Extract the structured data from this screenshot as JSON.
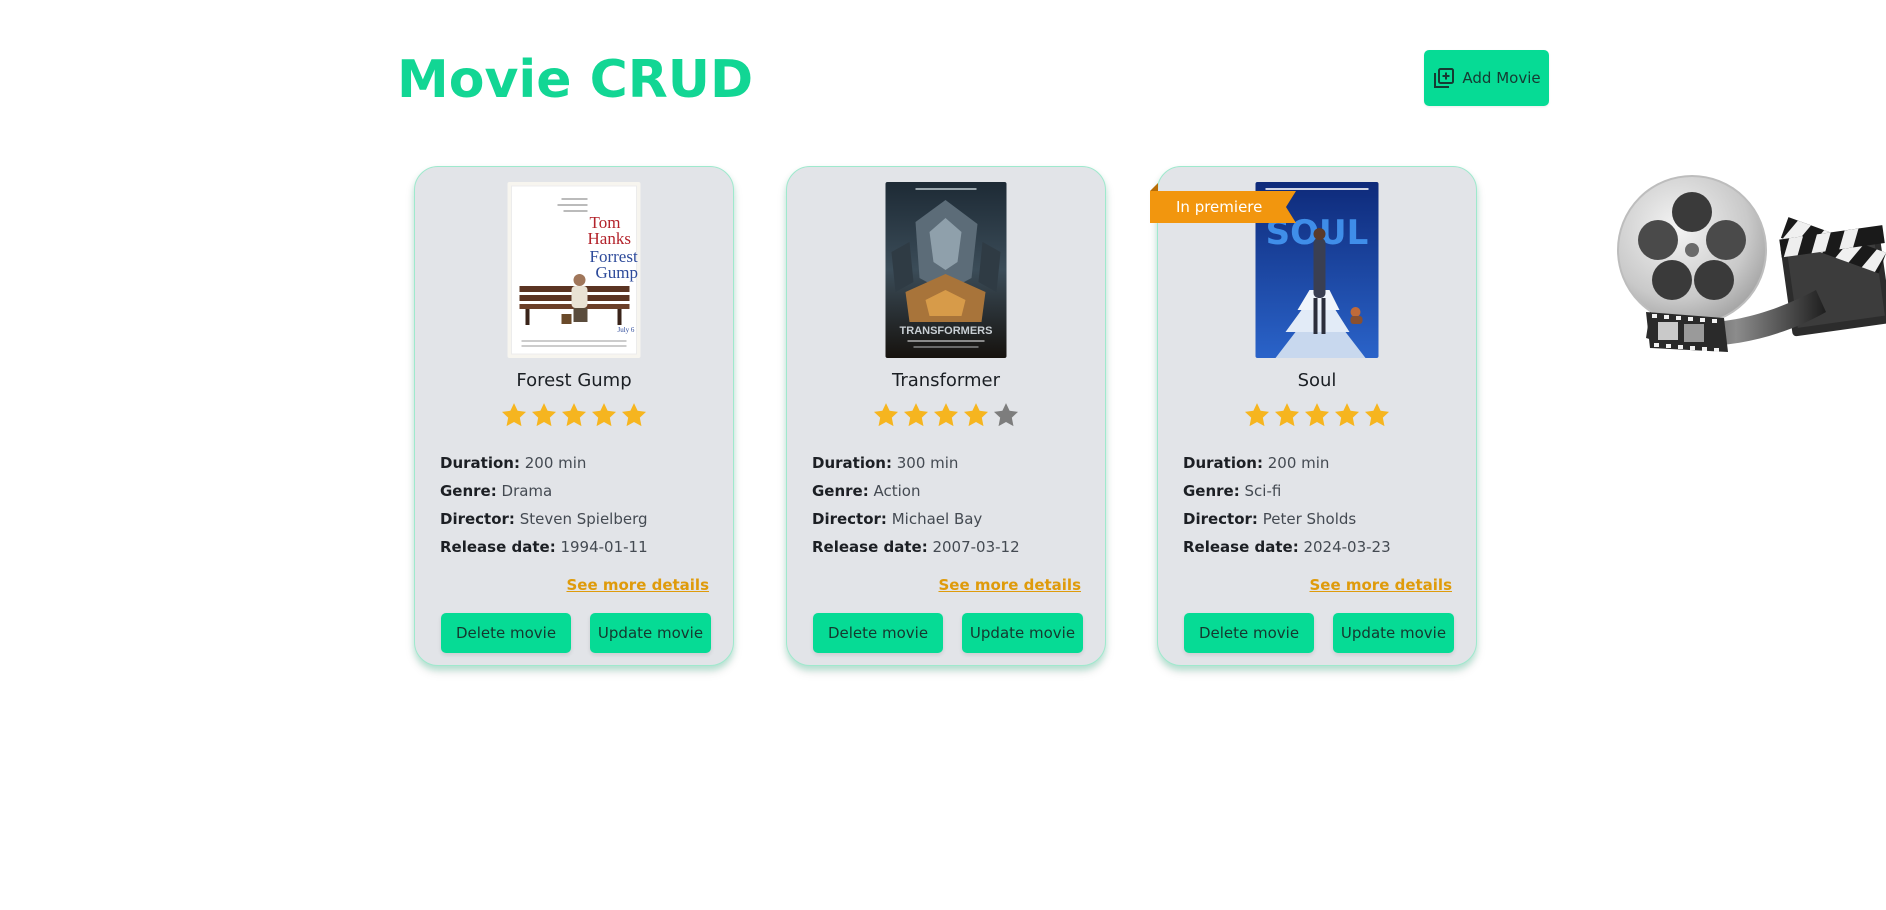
{
  "header": {
    "title": "Movie CRUD",
    "add_button_label": "Add Movie",
    "add_button_icon": "library-add-icon"
  },
  "colors": {
    "accent": "#06db95",
    "title": "#12d694",
    "link": "#df9b0b",
    "star_filled": "#f6b51f",
    "star_empty": "#7d7d7d",
    "ribbon": "#f2960e",
    "card_bg": "#e2e4e8"
  },
  "movies": [
    {
      "title": "Forest Gump",
      "rating": 5,
      "rating_max": 5,
      "duration_label": "Duration:",
      "duration": "200 min",
      "genre_label": "Genre:",
      "genre": "Drama",
      "director_label": "Director:",
      "director": "Steven Spielberg",
      "release_label": "Release date:",
      "release_date": "1994-01-11",
      "details_link": "See more details",
      "delete_label": "Delete movie",
      "update_label": "Update movie",
      "poster_text": [
        "Tom",
        "Hanks",
        "Forrest",
        "Gump"
      ]
    },
    {
      "title": "Transformer",
      "rating": 4,
      "rating_max": 5,
      "duration_label": "Duration:",
      "duration": "300 min",
      "genre_label": "Genre:",
      "genre": "Action",
      "director_label": "Director:",
      "director": "Michael Bay",
      "release_label": "Release date:",
      "release_date": "2007-03-12",
      "details_link": "See more details",
      "delete_label": "Delete movie",
      "update_label": "Update movie",
      "poster_text": [
        "TRANSFORMERS"
      ]
    },
    {
      "title": "Soul",
      "rating": 5,
      "rating_max": 5,
      "badge": "In premiere",
      "duration_label": "Duration:",
      "duration": "200 min",
      "genre_label": "Genre:",
      "genre": "Sci-fi",
      "director_label": "Director:",
      "director": "Peter Sholds",
      "release_label": "Release date:",
      "release_date": "2024-03-23",
      "details_link": "See more details",
      "delete_label": "Delete movie",
      "update_label": "Update movie",
      "poster_text": [
        "SOUL"
      ]
    }
  ],
  "decoration": {
    "icon": "film-reel-clapperboard-icon"
  }
}
